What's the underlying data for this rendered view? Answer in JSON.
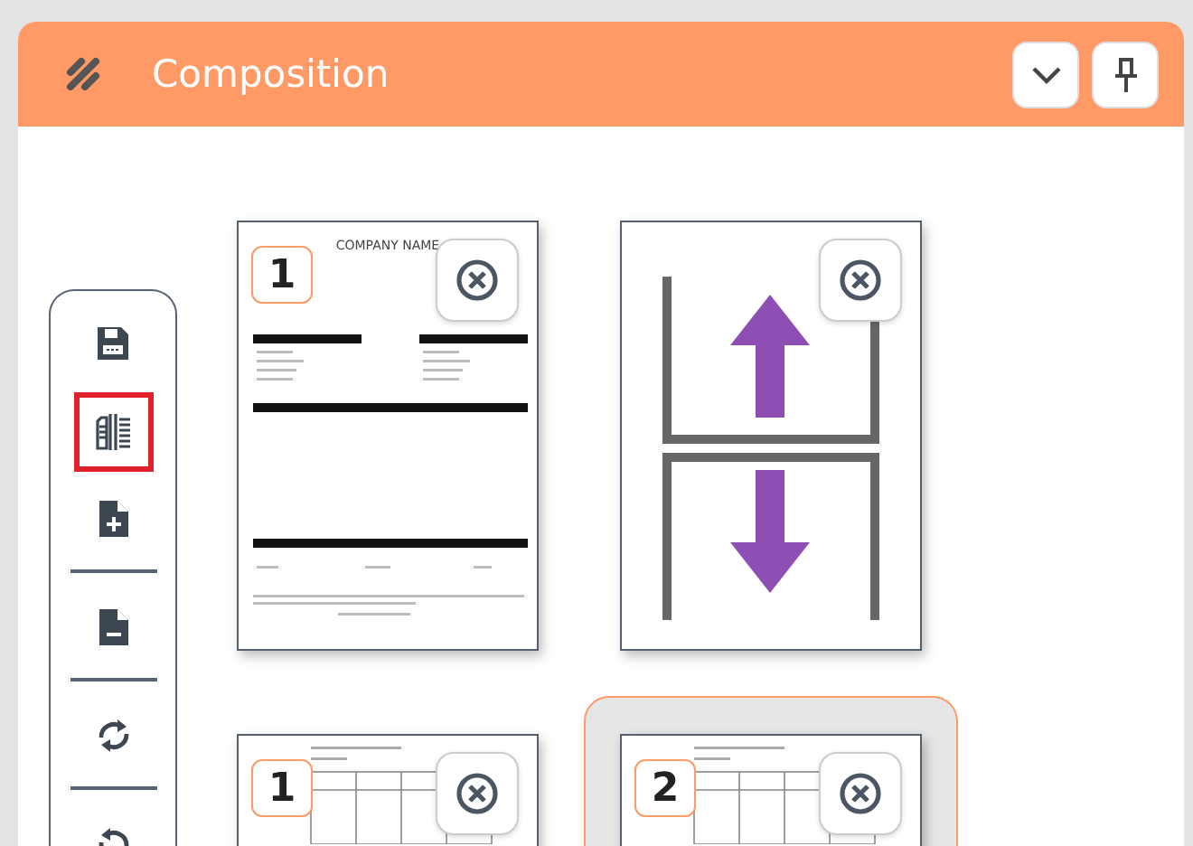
{
  "panel": {
    "title": "Composition",
    "header_buttons": [
      {
        "kind": "collapse"
      },
      {
        "kind": "pin"
      }
    ]
  },
  "toolbar": [
    {
      "kind": "save",
      "selected": false,
      "separator_after": false
    },
    {
      "kind": "split",
      "selected": true,
      "separator_after": false
    },
    {
      "kind": "add-page",
      "selected": false,
      "separator_after": true
    },
    {
      "kind": "remove-page",
      "selected": false,
      "separator_after": true
    },
    {
      "kind": "rotate-right",
      "selected": false,
      "separator_after": true
    },
    {
      "kind": "rotate-left",
      "selected": false,
      "separator_after": false
    }
  ],
  "pages": [
    {
      "kind": "invoice",
      "number": "1",
      "heading": "COMPANY NAME",
      "selected": false
    },
    {
      "kind": "move-target",
      "selected": false
    },
    {
      "kind": "table",
      "number": "1",
      "selected": false
    },
    {
      "kind": "table",
      "number": "2",
      "selected": true
    }
  ]
}
